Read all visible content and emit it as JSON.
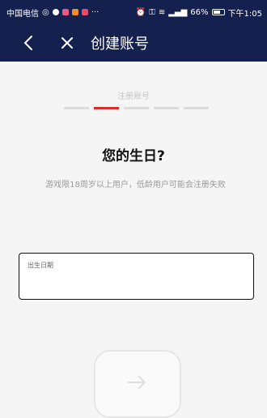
{
  "status_bar": {
    "carrier": "中国电信",
    "battery": "66%",
    "time": "下午1:05"
  },
  "header": {
    "title": "创建账号"
  },
  "step": {
    "label": "注册账号",
    "total": 5,
    "current": 2
  },
  "question": "您的生日?",
  "subtext": "游戏限18周岁以上用户，低龄用户可能会注册失败",
  "birthday_field": {
    "label": "出生日期",
    "value": ""
  },
  "colors": {
    "header_bg": "#14204d",
    "accent": "#d0322b"
  },
  "icons": {
    "back": "chevron-left-icon",
    "close": "close-icon",
    "next": "arrow-right-icon"
  }
}
